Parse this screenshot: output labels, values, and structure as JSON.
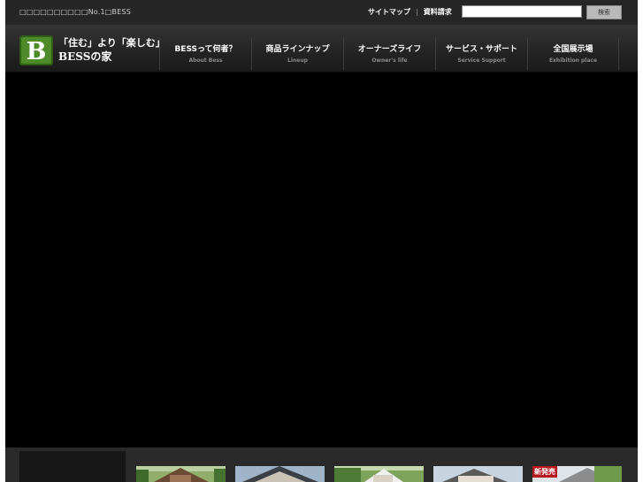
{
  "header": {
    "tagline": "□□□□□□□□□□No.1□BESS",
    "links": [
      {
        "label": "サイトマップ"
      },
      {
        "label": "資料請求"
      }
    ],
    "link_separator": "|",
    "search": {
      "value": "",
      "placeholder": "",
      "button_label": "検索"
    }
  },
  "logo": {
    "letter": "B",
    "line1": "「住む」より「楽しむ」",
    "line2": "BESSの家",
    "colors": {
      "green": "#4f8a2a",
      "dark_green": "#2f5e18"
    }
  },
  "nav": {
    "items": [
      {
        "jp": "BESSって何者？",
        "en": "About Bess"
      },
      {
        "jp": "商品ラインナップ",
        "en": "Lineup"
      },
      {
        "jp": "オーナーズライフ",
        "en": "Owner's life"
      },
      {
        "jp": "サービス・サポート",
        "en": "Service Support"
      },
      {
        "jp": "全国展示場",
        "en": "Exhibition place"
      }
    ]
  },
  "thumbnails": {
    "badge": "新発売",
    "items": [
      {
        "icon": "house-photo-icon"
      },
      {
        "icon": "house-photo-icon"
      },
      {
        "icon": "house-photo-icon"
      },
      {
        "icon": "house-photo-icon"
      },
      {
        "icon": "house-photo-icon"
      }
    ]
  }
}
